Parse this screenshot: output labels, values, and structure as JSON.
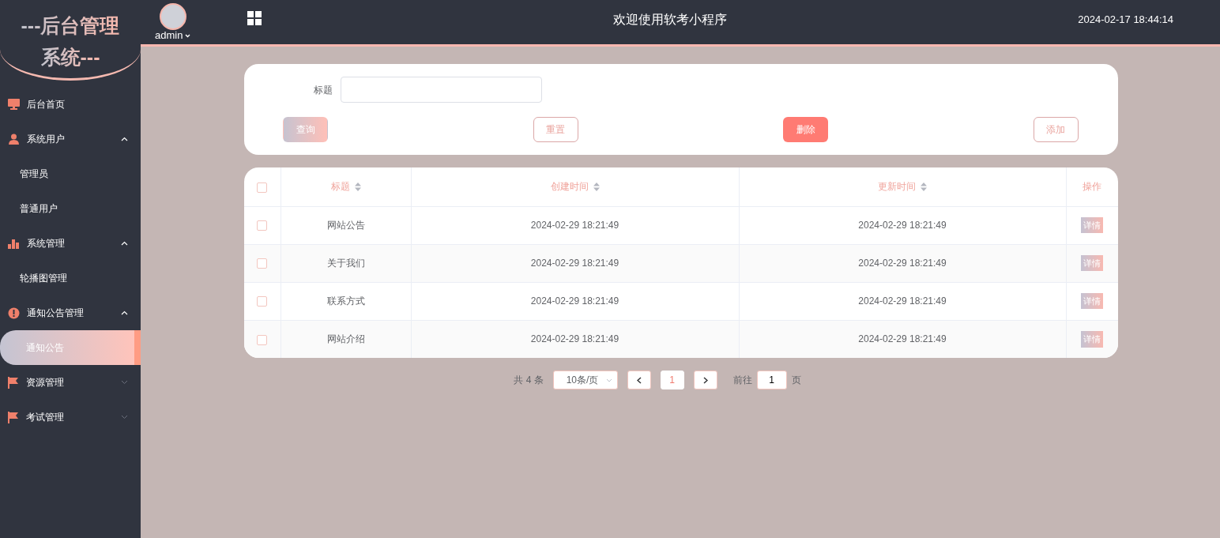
{
  "sidebar": {
    "logo_lines": [
      "---后台管理",
      "系统---"
    ],
    "items": [
      {
        "label": "后台首页",
        "selected": false
      },
      {
        "label": "系统用户",
        "expanded": true,
        "selected": false,
        "children": [
          {
            "label": "管理员",
            "selected": false
          },
          {
            "label": "普通用户",
            "selected": false
          }
        ]
      },
      {
        "label": "系统管理",
        "expanded": true,
        "selected": false,
        "children": [
          {
            "label": "轮播图管理",
            "selected": false
          }
        ]
      },
      {
        "label": "通知公告管理",
        "expanded": true,
        "selected": false,
        "children": [
          {
            "label": "通知公告",
            "selected": true
          }
        ]
      },
      {
        "label": "资源管理",
        "expanded": false,
        "selected": false
      },
      {
        "label": "考试管理",
        "expanded": false,
        "selected": false
      }
    ]
  },
  "header": {
    "user": "admin",
    "title": "欢迎使用软考小程序",
    "datetime": "2024-02-17 18:44:14"
  },
  "search": {
    "label": "标题"
  },
  "buttons": [
    {
      "label": "查询",
      "kind": "gradient"
    },
    {
      "label": "重置",
      "kind": "outline"
    },
    {
      "label": "删除",
      "kind": "danger"
    },
    {
      "label": "添加",
      "kind": "outline"
    }
  ],
  "table": {
    "all_checked": false,
    "columns": [
      {
        "label": "标题",
        "sortable": true
      },
      {
        "label": "创建时间",
        "sortable": true
      },
      {
        "label": "更新时间",
        "sortable": true
      },
      {
        "label": "操作",
        "sortable": false
      }
    ],
    "rows": [
      {
        "checked": false,
        "title": "网站公告",
        "created": "2024-02-29 18:21:49",
        "updated": "2024-02-29 18:21:49",
        "action": "详情"
      },
      {
        "checked": false,
        "title": "关于我们",
        "created": "2024-02-29 18:21:49",
        "updated": "2024-02-29 18:21:49",
        "action": "详情"
      },
      {
        "checked": false,
        "title": "联系方式",
        "created": "2024-02-29 18:21:49",
        "updated": "2024-02-29 18:21:49",
        "action": "详情"
      },
      {
        "checked": false,
        "title": "网站介绍",
        "created": "2024-02-29 18:21:49",
        "updated": "2024-02-29 18:21:49",
        "action": "详情"
      }
    ]
  },
  "pagination": {
    "total": "共 4 条",
    "page_size": "10条/页",
    "pages": [
      {
        "label": "1",
        "selected": true
      }
    ],
    "goto_label": "前往",
    "goto_value": "1",
    "goto_suffix": "页"
  }
}
